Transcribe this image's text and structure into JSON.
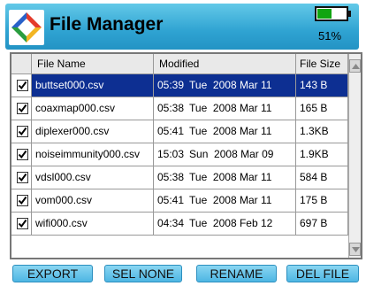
{
  "header": {
    "title": "File Manager",
    "battery_percent_label": "51%",
    "battery_level": 0.51,
    "logo_icon": "app-logo-icon"
  },
  "table": {
    "columns": [
      "",
      "File Name",
      "Modified",
      "File Size"
    ],
    "rows": [
      {
        "checked": true,
        "name": "buttset000.csv",
        "time": "05:39",
        "date": "Tue  2008 Mar 11",
        "size": "143 B",
        "selected": true
      },
      {
        "checked": true,
        "name": "coaxmap000.csv",
        "time": "05:38",
        "date": "Tue  2008 Mar 11",
        "size": "165 B",
        "selected": false
      },
      {
        "checked": true,
        "name": "diplexer000.csv",
        "time": "05:41",
        "date": "Tue  2008 Mar 11",
        "size": "1.3KB",
        "selected": false
      },
      {
        "checked": true,
        "name": "noiseimmunity000.csv",
        "time": "15:03",
        "date": "Sun  2008 Mar 09",
        "size": "1.9KB",
        "selected": false
      },
      {
        "checked": true,
        "name": "vdsl000.csv",
        "time": "05:38",
        "date": "Tue  2008 Mar 11",
        "size": "584 B",
        "selected": false
      },
      {
        "checked": true,
        "name": "vom000.csv",
        "time": "05:41",
        "date": "Tue  2008 Mar 11",
        "size": "175 B",
        "selected": false
      },
      {
        "checked": true,
        "name": "wifi000.csv",
        "time": "04:34",
        "date": "Tue  2008 Feb 12",
        "size": "697 B",
        "selected": false
      }
    ]
  },
  "buttons": {
    "export": "EXPORT",
    "sel_none": "SEL NONE",
    "rename": "RENAME",
    "del_file": "DEL FILE"
  },
  "colors": {
    "titlebar": "#2fa3d2",
    "selection": "#0d2f92",
    "battery": "#11a511",
    "button": "#4eb6e3"
  }
}
